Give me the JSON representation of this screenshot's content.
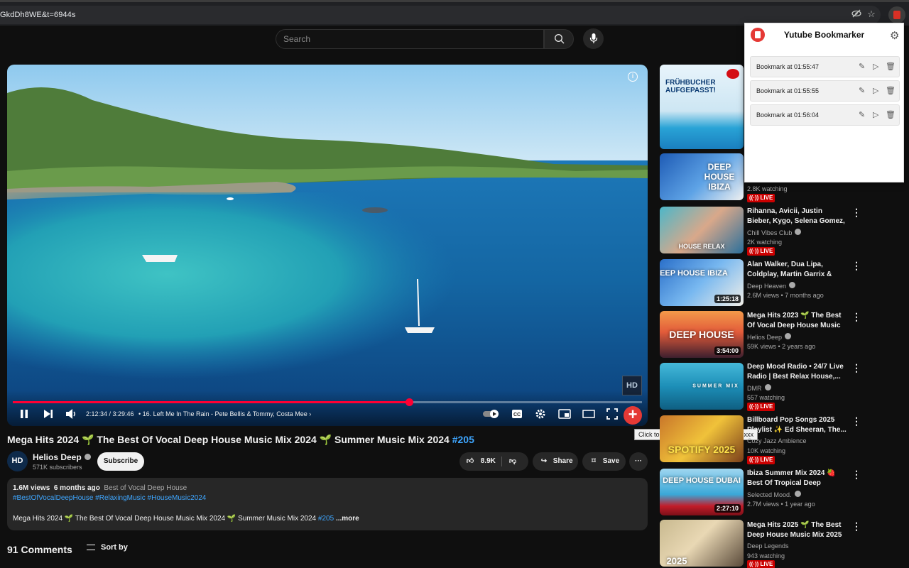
{
  "browser": {
    "url": "GkdDh8WE&t=6944s",
    "icons": [
      "eye-slash-icon",
      "star-icon",
      "extension-icon"
    ]
  },
  "header": {
    "search_placeholder": "Search"
  },
  "player": {
    "time": "2:12:34 / 3:29:46",
    "chapter": "• 16. Left Me In The Rain - Pete Bellis & Tommy, Costa Mee",
    "progress": 0.63,
    "channel_logo": "HD",
    "tooltip": "Click to bookmark current timestamp xxx"
  },
  "video": {
    "title": "Mega Hits 2024 🌱 The Best Of Vocal Deep House Music Mix 2024 🌱 Summer Music Mix 2024",
    "title_hashtag": "#205",
    "channel": "Helios Deep",
    "avatar_text": "HD",
    "subscribers": "571K subscribers",
    "subscribe_label": "Subscribe",
    "likes": "8.9K",
    "share_label": "Share",
    "save_label": "Save"
  },
  "description": {
    "views": "1.6M views",
    "age": "6 months ago",
    "category": "Best of Vocal Deep House",
    "tags": "#BestOfVocalDeepHouse #RelaxingMusic #HouseMusic2024",
    "text": "Mega Hits 2024 🌱 The Best Of Vocal Deep House Music Mix 2024 🌱 Summer Music Mix 2024",
    "text_hashtag": "#205",
    "more": "...more"
  },
  "comments": {
    "count": "91 Comments",
    "sort": "Sort by"
  },
  "sidebar": {
    "items": [
      {
        "thumb_text": "FRÜHBUCHER AUFGEPASST!",
        "title": "",
        "channel": "",
        "stats": "",
        "duration": "",
        "live": ""
      },
      {
        "thumb_text": "DEEP HOUSE IBIZA",
        "title": "",
        "channel": "",
        "stats": "2.8K watching",
        "duration": "",
        "live": "LIVE"
      },
      {
        "thumb_text": "HOUSE RELAX",
        "title": "Rihanna, Avicii, Justin Bieber, Kygo, Selena Gomez, Alok,...",
        "channel": "Chill Vibes Club",
        "stats": "2K watching",
        "duration": "",
        "live": "LIVE"
      },
      {
        "thumb_text": "DEEP HOUSE IBIZA",
        "title": "Alan Walker, Dua Lipa, Coldplay, Martin Garrix & Kygo, The...",
        "channel": "Deep Heaven",
        "stats": "2.6M views • 7 months ago",
        "duration": "1:25:18",
        "live": ""
      },
      {
        "thumb_text": "DEEP HOUSE",
        "title": "Mega Hits 2023 🌱 The Best Of Vocal Deep House Music Mix...",
        "channel": "Helios Deep",
        "stats": "59K views • 2 years ago",
        "duration": "3:54:00",
        "live": ""
      },
      {
        "thumb_text": "SUMMER MIX",
        "title": "Deep Mood Radio • 24/7 Live Radio | Best Relax House,...",
        "channel": "DMR",
        "stats": "557 watching",
        "duration": "",
        "live": "LIVE"
      },
      {
        "thumb_text": "SPOTIFY 2025",
        "title": "Billboard Pop Songs 2025 Playlist ✨ Ed Sheeran, The...",
        "channel": "Cozy Jazz Ambience",
        "stats": "10K watching",
        "duration": "",
        "live": "LIVE"
      },
      {
        "thumb_text": "DEEP HOUSE DUBAI",
        "title": "Ibiza Summer Mix 2024 🍓 Best Of Tropical Deep House...",
        "channel": "Selected Mood.",
        "stats": "2.7M views • 1 year ago",
        "duration": "2:27:10",
        "live": ""
      },
      {
        "thumb_text": "2025",
        "title": "Mega Hits 2025 🌱 The Best Deep House Music Mix 2025 ...",
        "channel": "Deep Legends",
        "stats": "943 watching",
        "duration": "",
        "live": "LIVE"
      }
    ]
  },
  "extension": {
    "title": "Yutube Bookmarker",
    "bookmarks": [
      {
        "label": "Bookmark at 01:55:47"
      },
      {
        "label": "Bookmark at 01:55:55"
      },
      {
        "label": "Bookmark at 01:56:04"
      }
    ],
    "accent": "#e53935"
  }
}
